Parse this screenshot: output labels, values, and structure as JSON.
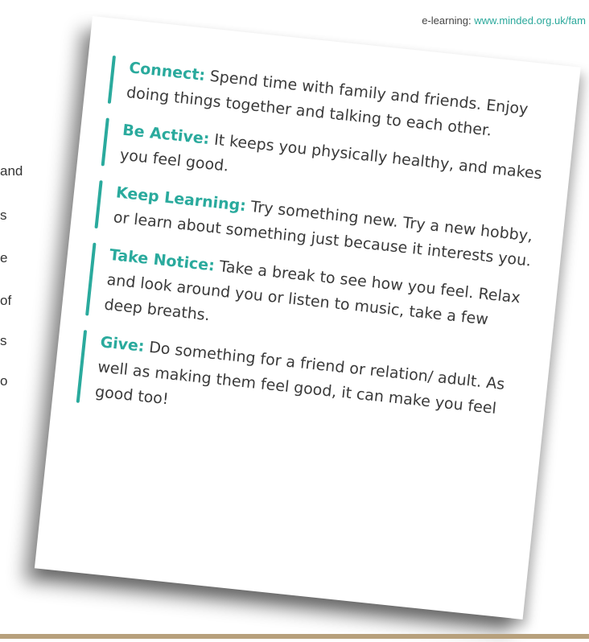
{
  "background": {
    "side_words": [
      "and",
      "s",
      "e",
      "of",
      "s",
      "o"
    ],
    "caption_prefix": "e-learning:",
    "caption_url": "www.minded.org.uk/fam"
  },
  "tips": [
    {
      "heading": "Connect:",
      "text": " Spend time with family and friends. Enjoy doing things together and talking to each other."
    },
    {
      "heading": "Be Active:",
      "text": "  It keeps you physically healthy, and makes you feel good."
    },
    {
      "heading": "Keep Learning:",
      "text": " Try something new. Try a new hobby, or learn about something just because it interests you."
    },
    {
      "heading": "Take Notice:",
      "text": " Take a break to see how you feel. Relax and look around you or listen to music, take a few deep breaths."
    },
    {
      "heading": "Give:",
      "text": " Do something for a friend or relation/ adult. As well as making them feel good, it can make you feel good too!"
    }
  ],
  "colors": {
    "accent": "#2aaa9d",
    "text": "#3a3a3a",
    "rule": "#b7a07c"
  }
}
